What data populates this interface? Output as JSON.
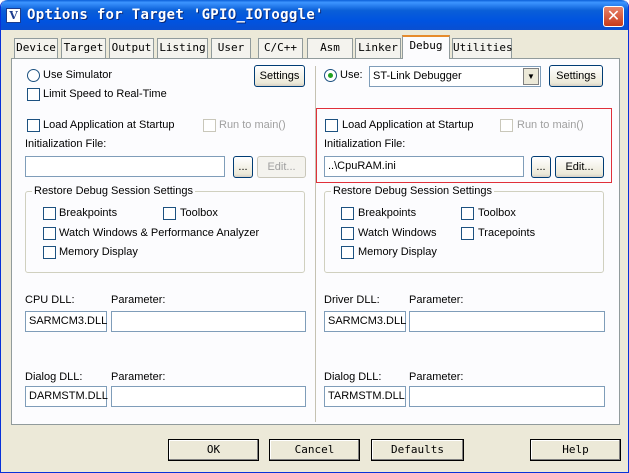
{
  "window": {
    "title": "Options for Target 'GPIO_IOToggle'",
    "app_icon": "V",
    "close": "✕"
  },
  "tabs": [
    "Device",
    "Target",
    "Output",
    "Listing",
    "User",
    "C/C++",
    "Asm",
    "Linker",
    "Debug",
    "Utilities"
  ],
  "active_tab": "Debug",
  "left": {
    "use_simulator": "Use Simulator",
    "settings": "Settings",
    "limit_speed": "Limit Speed to Real-Time",
    "load_app": "Load Application at Startup",
    "run_to_main": "Run to main()",
    "init_file_label": "Initialization File:",
    "init_file_value": "",
    "browse": "...",
    "edit": "Edit...",
    "restore_title": "Restore Debug Session Settings",
    "breakpoints": "Breakpoints",
    "toolbox": "Toolbox",
    "watch_windows": "Watch Windows & Performance Analyzer",
    "memory_display": "Memory Display",
    "cpu_dll_label": "CPU DLL:",
    "cpu_param_label": "Parameter:",
    "cpu_dll_value": "SARMCM3.DLL",
    "cpu_param_value": "",
    "dialog_dll_label": "Dialog DLL:",
    "dialog_param_label": "Parameter:",
    "dialog_dll_value": "DARMSTM.DLL",
    "dialog_param_value": ""
  },
  "right": {
    "use": "Use:",
    "debugger": "ST-Link Debugger",
    "settings": "Settings",
    "load_app": "Load Application at Startup",
    "run_to_main": "Run to main()",
    "init_file_label": "Initialization File:",
    "init_file_value": "..\\CpuRAM.ini",
    "browse": "...",
    "edit": "Edit...",
    "restore_title": "Restore Debug Session Settings",
    "breakpoints": "Breakpoints",
    "toolbox": "Toolbox",
    "watch_windows": "Watch Windows",
    "tracepoints": "Tracepoints",
    "memory_display": "Memory Display",
    "driver_dll_label": "Driver DLL:",
    "driver_param_label": "Parameter:",
    "driver_dll_value": "SARMCM3.DLL",
    "driver_param_value": "",
    "dialog_dll_label": "Dialog DLL:",
    "dialog_param_label": "Parameter:",
    "dialog_dll_value": "TARMSTM.DLL",
    "dialog_param_value": ""
  },
  "footer": {
    "ok": "OK",
    "cancel": "Cancel",
    "defaults": "Defaults",
    "help": "Help"
  },
  "colors": {
    "highlight_border": "#e0303a",
    "titlebar": "#0a5fd8",
    "active_tab_accent": "#e68b2c"
  }
}
